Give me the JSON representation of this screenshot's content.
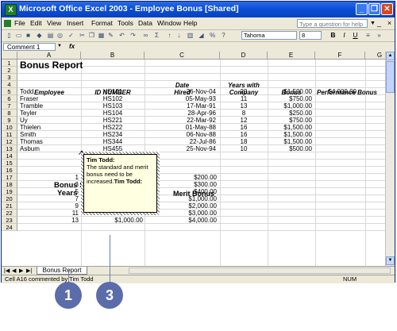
{
  "window": {
    "title": "Microsoft Office Excel 2003 - Employee Bonus  [Shared]",
    "app_icon": "excel-icon",
    "buttons": {
      "minimize": "_",
      "restore": "❐",
      "close": "✕"
    }
  },
  "menu": {
    "items": [
      "File",
      "Edit",
      "View",
      "Insert",
      "Format",
      "Tools",
      "Data",
      "Window",
      "Help"
    ],
    "ask_placeholder": "Type a question for help"
  },
  "toolbar": {
    "font_name": "Tahoma",
    "font_size": "8",
    "bold": "B",
    "italic": "I",
    "underline": "U"
  },
  "formula_bar": {
    "name_box": "Comment 1",
    "fx": "fx"
  },
  "columns": [
    "A",
    "B",
    "C",
    "D",
    "E",
    "F",
    "G"
  ],
  "rows": [
    "1",
    "2",
    "3",
    "4",
    "5",
    "6",
    "7",
    "8",
    "9",
    "10",
    "11",
    "12",
    "13",
    "14",
    "15",
    "16",
    "17",
    "18",
    "19",
    "20",
    "21",
    "22",
    "23",
    "24"
  ],
  "sheet": {
    "title": "Bonus Report",
    "headers": {
      "employee": "Employee",
      "id": "ID NUMBER",
      "date_line1": "Date",
      "date_line2": "Hired",
      "years_line1": "Years with",
      "years_line2": "Company",
      "bonus": "Bonus",
      "performance": "Performance Bonus"
    },
    "employees": [
      {
        "name": "Todd",
        "id": "HS101",
        "date": "26-Nov-04",
        "years": "20",
        "bonus": "$1,500.00",
        "perf": "$4,000.00"
      },
      {
        "name": "Fraser",
        "id": "HS102",
        "date": "05-May-93",
        "years": "11",
        "bonus": "$750.00",
        "perf": ""
      },
      {
        "name": "Tramble",
        "id": "HS103",
        "date": "17-Mar-91",
        "years": "13",
        "bonus": "$1,000.00",
        "perf": ""
      },
      {
        "name": "Teyler",
        "id": "HS104",
        "date": "28-Apr-96",
        "years": "8",
        "bonus": "$250.00",
        "perf": ""
      },
      {
        "name": "Uy",
        "id": "HS221",
        "date": "22-Mar-92",
        "years": "12",
        "bonus": "$750.00",
        "perf": ""
      },
      {
        "name": "Thielen",
        "id": "HS222",
        "date": "01-May-88",
        "years": "16",
        "bonus": "$1,500.00",
        "perf": ""
      },
      {
        "name": "Smith",
        "id": "HS234",
        "date": "06-Nov-88",
        "years": "16",
        "bonus": "$1,500.00",
        "perf": ""
      },
      {
        "name": "Thomas",
        "id": "HS344",
        "date": "22-Jul-86",
        "years": "18",
        "bonus": "$1,500.00",
        "perf": ""
      },
      {
        "name": "Asbum",
        "id": "HS455",
        "date": "25-Nov-94",
        "years": "10",
        "bonus": "$500.00",
        "perf": ""
      }
    ],
    "schedule": {
      "title_partial": "Bonus Sc",
      "years_label": "Years",
      "merit_label": "Merit Bonus",
      "rows": [
        {
          "years": "1",
          "bonus": "",
          "merit": "$200.00"
        },
        {
          "years": "3",
          "bonus": "",
          "merit": "$300.00"
        },
        {
          "years": "5",
          "bonus": "$100.00",
          "merit": "$400.00"
        },
        {
          "years": "7",
          "bonus": "$250.00",
          "merit": "$1,000.00"
        },
        {
          "years": "9",
          "bonus": "$500.00",
          "merit": "$2,000.00"
        },
        {
          "years": "11",
          "bonus": "$750.00",
          "merit": "$3,000.00"
        },
        {
          "years": "13",
          "bonus": "$1,000.00",
          "merit": "$4,000.00"
        }
      ]
    }
  },
  "comment": {
    "author_line": "Tim Todd:",
    "text": "The standard and merit bonus need to be increased.",
    "signature": "Tim Todd:"
  },
  "sheet_tab": "Bonus Report",
  "status": {
    "left": "Cell A16 commented by Tim Todd",
    "num": "NUM"
  },
  "callouts": [
    "1",
    "3"
  ]
}
